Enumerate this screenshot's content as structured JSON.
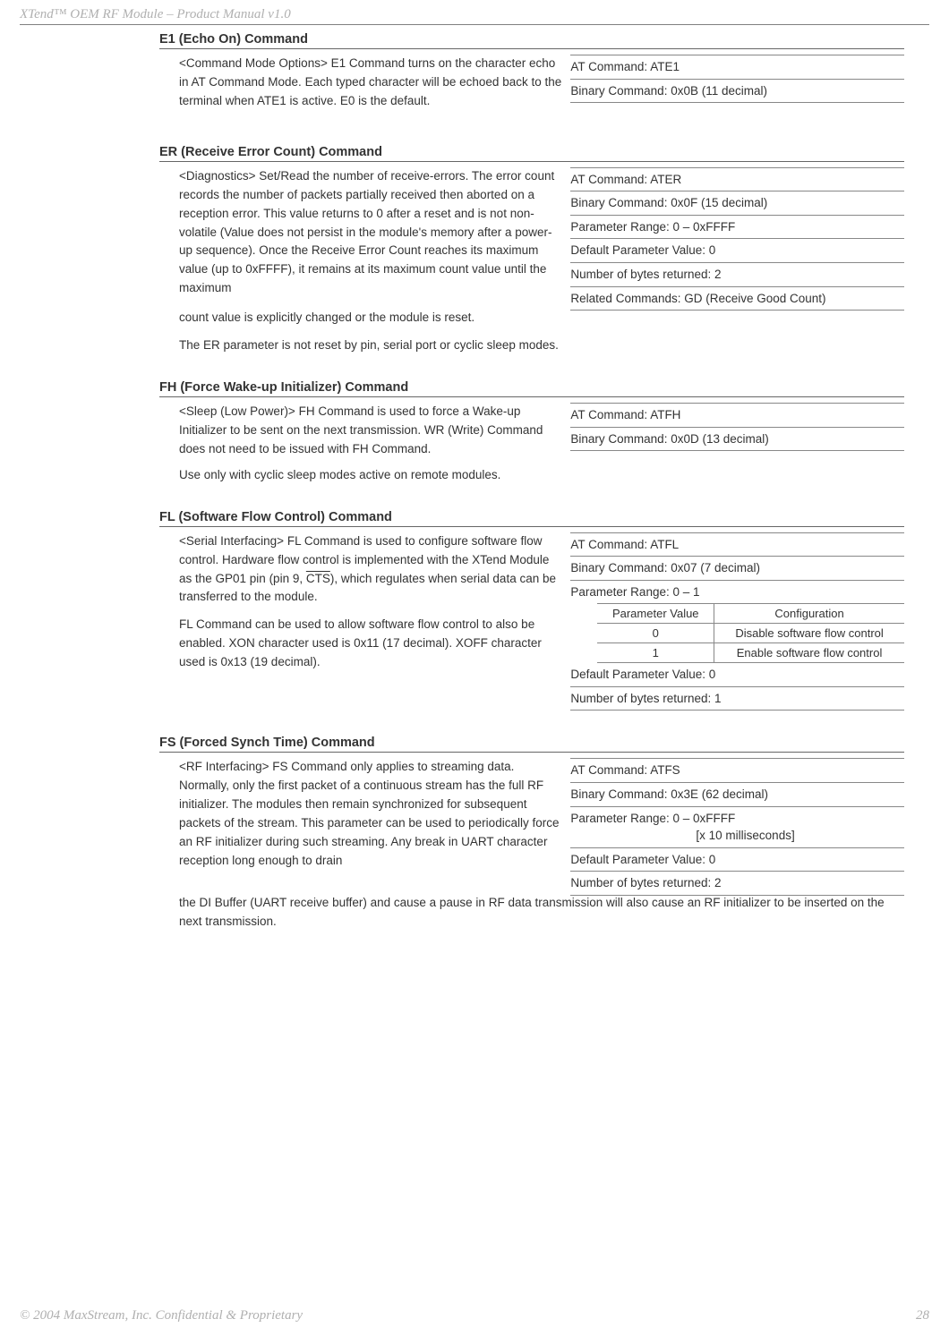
{
  "header": "XTend™ OEM RF Module – Product Manual v1.0",
  "footer_left": "© 2004 MaxStream, Inc. Confidential & Proprietary",
  "footer_right": "28",
  "e1": {
    "title": "E1 (Echo On) Command",
    "desc": "<Command Mode Options> E1 Command turns on the character echo in AT Command Mode. Each typed character will be echoed back to the terminal when ATE1 is active. E0 is the default.",
    "rows": {
      "at": "AT Command: ATE1",
      "bin": "Binary Command: 0x0B (11 decimal)"
    }
  },
  "er": {
    "title": "ER (Receive Error Count) Command",
    "desc": "<Diagnostics> Set/Read the number of receive-errors. The error count records the number of packets partially received then aborted on a reception error. This value returns to 0 after a reset and is not non-volatile (Value does not persist in the module's memory after a power-up sequence). Once the Receive Error Count reaches its maximum value (up to 0xFFFF), it remains at its maximum count value until the maximum",
    "trail1": "count value is explicitly changed or the module is reset.",
    "trail2": "The ER parameter is not reset by pin, serial port or cyclic sleep modes.",
    "rows": {
      "at": "AT Command: ATER",
      "bin": "Binary Command: 0x0F (15 decimal)",
      "range": "Parameter Range: 0 – 0xFFFF",
      "def": "Default Parameter Value: 0",
      "bytes": "Number of bytes returned: 2",
      "rel": "Related Commands: GD (Receive Good Count)"
    }
  },
  "fh": {
    "title": "FH (Force Wake-up Initializer) Command",
    "desc": "<Sleep (Low Power)> FH Command is used to force a Wake-up Initializer to be sent on the next transmission. WR (Write) Command does not need to be issued with FH Command.",
    "trail": "Use only with cyclic sleep modes active on remote modules.",
    "rows": {
      "at": "AT Command: ATFH",
      "bin": "Binary Command: 0x0D (13 decimal)"
    }
  },
  "fl": {
    "title": "FL (Software Flow Control) Command",
    "desc1a": "<Serial Interfacing> FL Command is used to configure software flow control. Hardware flow control is implemented with the XTend Module as the GP01 pin (pin 9, ",
    "desc1cts": "CTS",
    "desc1b": "), which regulates when serial data can be transferred to the module.",
    "desc2": "FL Command can be used to allow software flow control to also be enabled. XON character used is 0x11 (17 decimal). XOFF character used is 0x13 (19 decimal).",
    "rows": {
      "at": "AT Command: ATFL",
      "bin": "Binary Command: 0x07 (7 decimal)",
      "range": "Parameter Range: 0 – 1",
      "def": "Default Parameter Value: 0",
      "bytes": "Number of bytes returned: 1"
    },
    "table": {
      "h1": "Parameter Value",
      "h2": "Configuration",
      "r0v": "0",
      "r0c": "Disable software flow control",
      "r1v": "1",
      "r1c": "Enable software flow control"
    }
  },
  "fs": {
    "title": "FS (Forced Synch Time) Command",
    "desc": "<RF Interfacing> FS Command only applies to streaming data. Normally, only the first packet of a continuous stream has the full RF initializer. The modules then remain synchronized for subsequent packets of the stream. This parameter can be used to periodically force an RF initializer during such streaming. Any break in UART character reception long enough to drain",
    "trail": "the DI Buffer (UART receive buffer) and cause a pause in RF data transmission will also cause an RF initializer to be inserted on the next transmission.",
    "rows": {
      "at": "AT Command: ATFS",
      "bin": "Binary Command: 0x3E (62 decimal)",
      "range": "Parameter Range: 0 – 0xFFFF",
      "range_sub": "[x 10 milliseconds]",
      "def": "Default Parameter Value: 0",
      "bytes": "Number of bytes returned: 2"
    }
  }
}
